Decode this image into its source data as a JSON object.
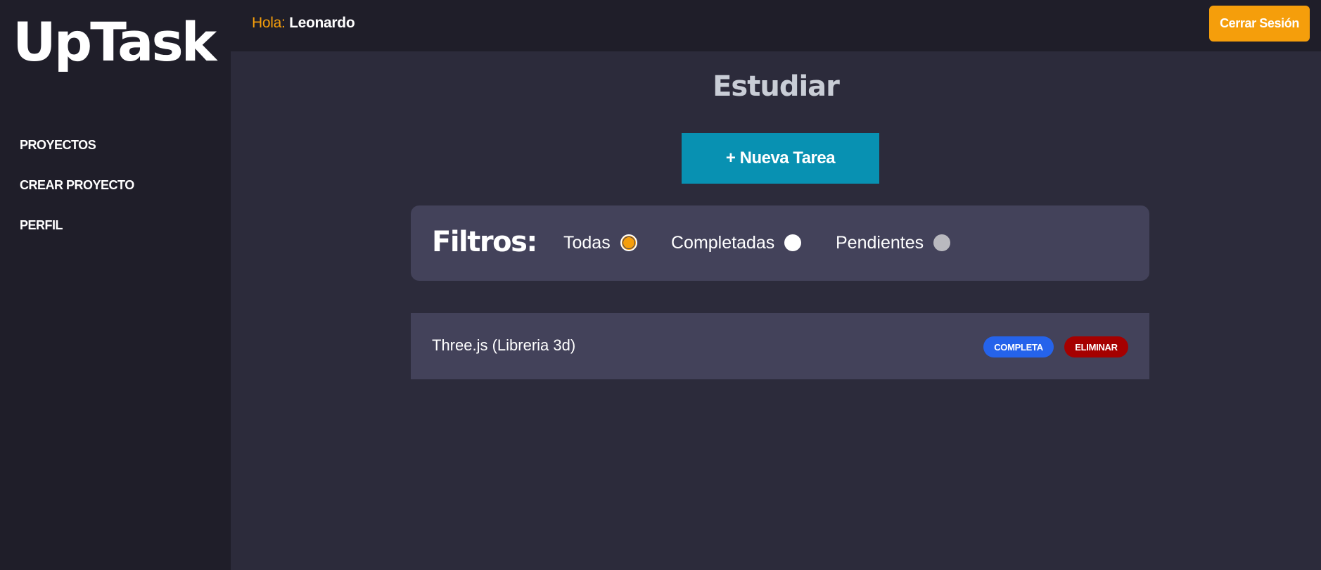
{
  "app": {
    "logo": "UpTask"
  },
  "sidebar": {
    "items": [
      {
        "label": "PROYECTOS"
      },
      {
        "label": "CREAR PROYECTO"
      },
      {
        "label": "PERFIL"
      }
    ]
  },
  "header": {
    "greeting_prefix": "Hola:",
    "user_name": "Leonardo",
    "logout_label": "Cerrar Sesión"
  },
  "main": {
    "project_title": "Estudiar",
    "new_task_label": "+ Nueva Tarea",
    "filters": {
      "label": "Filtros:",
      "options": [
        {
          "label": "Todas",
          "checked": true
        },
        {
          "label": "Completadas",
          "checked": false
        },
        {
          "label": "Pendientes",
          "checked": false
        }
      ]
    },
    "tasks": [
      {
        "name": "Three.js (Libreria 3d)",
        "status_label": "COMPLETA",
        "delete_label": "ELIMINAR"
      }
    ]
  },
  "colors": {
    "accent": "#f59e0b",
    "primary_button": "#0891b2",
    "complete_badge": "#2563eb",
    "delete_badge": "#a50000",
    "sidebar_bg": "#1f1e29",
    "main_bg": "#2c2b3b",
    "panel_bg": "#43425a"
  }
}
